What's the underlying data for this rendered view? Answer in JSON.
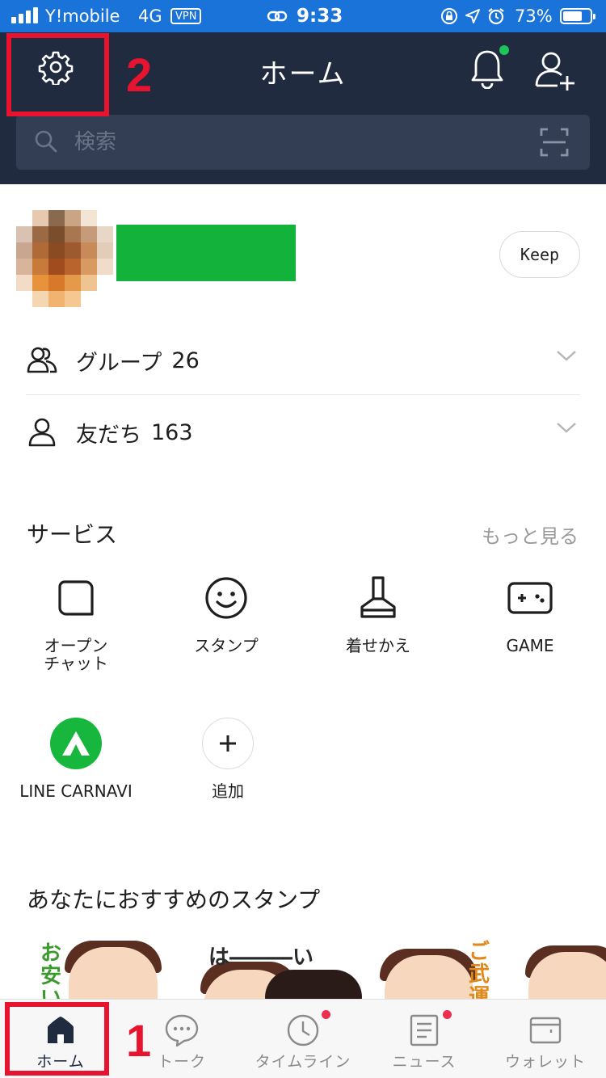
{
  "status_bar": {
    "carrier": "Y!mobile",
    "network": "4G",
    "vpn": "VPN",
    "time": "9:33",
    "battery_percent": "73%",
    "battery_level": 0.73
  },
  "header": {
    "title": "ホーム",
    "search_placeholder": "検索",
    "notification_dot_color": "#1ec35a",
    "background_color": "#212b40"
  },
  "annotations": {
    "settings_marker": "2",
    "home_tab_marker": "1",
    "color": "#e8132f"
  },
  "profile": {
    "keep_label": "Keep",
    "name_redaction_color": "#13b23a"
  },
  "lists": {
    "groups": {
      "label": "グループ",
      "count": "26"
    },
    "friends": {
      "label": "友だち",
      "count": "163"
    }
  },
  "services": {
    "title": "サービス",
    "more_label": "もっと見る",
    "items": [
      {
        "label": "オープン\nチャット",
        "icon": "open-chat-icon"
      },
      {
        "label": "スタンプ",
        "icon": "sticker-smile-icon"
      },
      {
        "label": "着せかえ",
        "icon": "theme-brush-icon"
      },
      {
        "label": "GAME",
        "icon": "game-controller-icon"
      },
      {
        "label": "LINE CARNAVI",
        "icon": "carnavi-icon"
      },
      {
        "label": "追加",
        "icon": "plus-icon"
      }
    ]
  },
  "recommended": {
    "title": "あなたにおすすめのスタンプ",
    "sticker_texts": [
      "お安い",
      "は―――い",
      "ご武運"
    ]
  },
  "tab_bar": {
    "tabs": [
      {
        "label": "ホーム",
        "icon": "home-icon",
        "active": true,
        "badge": false
      },
      {
        "label": "トーク",
        "icon": "chat-bubble-icon",
        "active": false,
        "badge": false
      },
      {
        "label": "タイムライン",
        "icon": "clock-icon",
        "active": false,
        "badge": true
      },
      {
        "label": "ニュース",
        "icon": "news-icon",
        "active": false,
        "badge": true
      },
      {
        "label": "ウォレット",
        "icon": "wallet-icon",
        "active": false,
        "badge": false
      }
    ],
    "badge_color": "#ee2e4e"
  }
}
